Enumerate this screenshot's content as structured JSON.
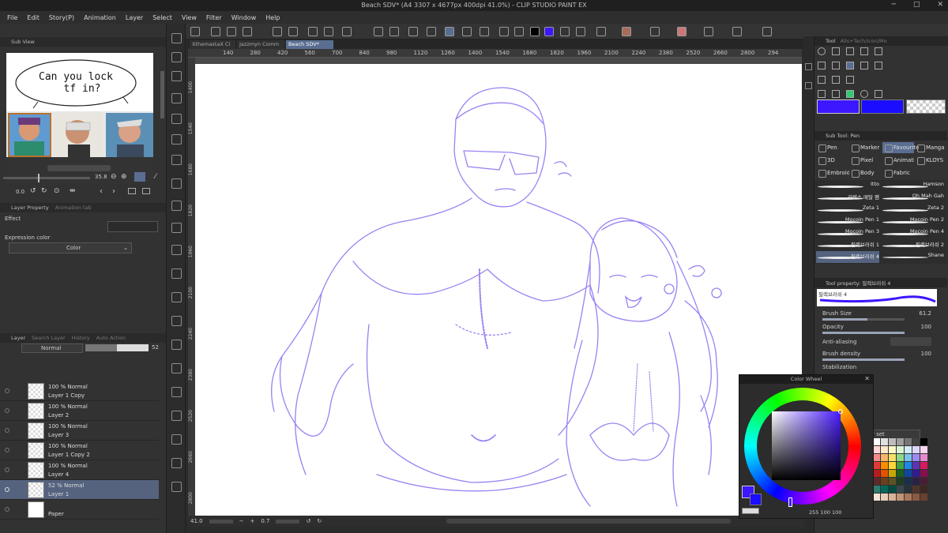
{
  "window": {
    "title": "Beach SDV* (A4 3307 x 4677px 400dpi 41.0%) - CLIP STUDIO PAINT EX",
    "min_glyph": "─",
    "max_glyph": "□",
    "close_glyph": "✕"
  },
  "menu": [
    "File",
    "Edit",
    "Story(P)",
    "Animation",
    "Layer",
    "Select",
    "View",
    "Filter",
    "Window",
    "Help"
  ],
  "subview": {
    "tab": "Sub View",
    "speech_line1": "Can you lock",
    "speech_line2": "tf in?",
    "zoom_value": "35.8",
    "rotate_value": "0.0"
  },
  "layer_property": {
    "tabs": [
      "Layer Property",
      "Animation tab"
    ],
    "effect_label": "Effect",
    "expression_label": "Expression color",
    "expression_value": "Color"
  },
  "layer_panel": {
    "tabs": [
      "Layer",
      "Search Layer",
      "History",
      "Auto Action"
    ],
    "blend_mode": "Normal",
    "opacity": "52",
    "layers": [
      {
        "line1": "100 % Normal",
        "line2": "Layer 1 Copy"
      },
      {
        "line1": "100 % Normal",
        "line2": "Layer 2"
      },
      {
        "line1": "100 % Normal",
        "line2": "Layer 3"
      },
      {
        "line1": "100 % Normal",
        "line2": "Layer 1 Copy 2"
      },
      {
        "line1": "100 % Normal",
        "line2": "Layer 4"
      },
      {
        "line1": "52 % Normal",
        "line2": "Layer 1"
      },
      {
        "line1": "",
        "line2": "Paper"
      }
    ]
  },
  "doc_tabs": [
    "XthemastaX Cl",
    "Jazzmyn Comm",
    "Beach SDV*"
  ],
  "ruler_labels": [
    "140",
    "280",
    "420",
    "560",
    "700",
    "840",
    "980",
    "1120",
    "1260",
    "1400",
    "1540",
    "1680",
    "1820",
    "1960",
    "2100",
    "2240",
    "2380",
    "2520",
    "2660",
    "2800",
    "294"
  ],
  "vruler_labels": [
    "1400",
    "1540",
    "1680",
    "1820",
    "1960",
    "2100",
    "2240",
    "2380",
    "2520",
    "2660",
    "2800"
  ],
  "status": {
    "zoom": "41.0",
    "angle": "0.7"
  },
  "tool_panel": {
    "tabs": [
      "Tool",
      "Alls+Tech/Icon/Mo"
    ]
  },
  "subtool_panel": {
    "tab": "Sub Tool: Pen",
    "groups": [
      "Pen",
      "Marker",
      "Favourite",
      "Manga",
      "3D",
      "Pixel",
      "Animation",
      "KLOYS",
      "Embroid",
      "Body",
      "Fabric"
    ],
    "brushes": [
      {
        "name": "Itto"
      },
      {
        "name": "Hamson"
      },
      {
        "name": "라텍스 메탈 펜"
      },
      {
        "name": "Oh Mah Gah"
      },
      {
        "name": "Zeta 1"
      },
      {
        "name": "Zeta 2"
      },
      {
        "name": "Mocoin Pen 1"
      },
      {
        "name": "Mocoin Pen 2"
      },
      {
        "name": "Mocoin Pen 3"
      },
      {
        "name": "Mocoin Pen 4"
      },
      {
        "name": "필렉브러쉬 1"
      },
      {
        "name": "필렉브러쉬 2"
      },
      {
        "name": "필렉브러쉬 4"
      },
      {
        "name": "Shane"
      }
    ]
  },
  "tool_property": {
    "tab": "Tool property: 필렉브러쉬 4",
    "preset_name": "필렉브러쉬 4",
    "brush_size_label": "Brush Size",
    "brush_size": "61.2",
    "brush_size_fraction": 0.55,
    "opacity_label": "Opacity",
    "opacity": "100",
    "opacity_fraction": 1.0,
    "antialias_label": "Anti-aliasing",
    "density_label": "Brush density",
    "density": "100",
    "density_fraction": 1.0,
    "stabilization_label": "Stabilization"
  },
  "color_wheel": {
    "title": "Color Wheel",
    "readout": "255  100  100",
    "main_color": "#3c17ff",
    "sub_color": "#1b0dff"
  },
  "color_set": {
    "label": "r set"
  },
  "colors": {
    "line_purple": "#8a6cf0",
    "accent": "#5a6e92"
  }
}
